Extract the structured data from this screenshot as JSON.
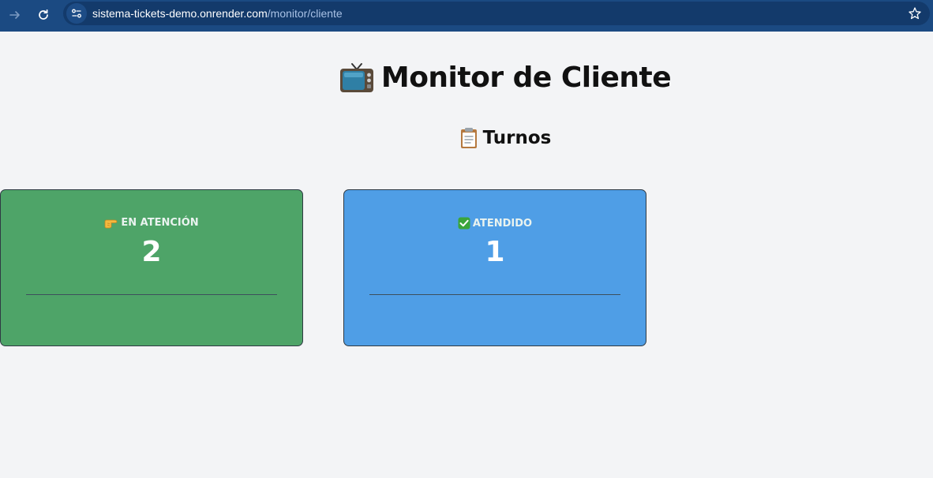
{
  "browser": {
    "url_host": "sistema-tickets-demo.onrender.com",
    "url_path": "/monitor/cliente",
    "icons": {
      "forward": "arrow-right-icon",
      "reload": "reload-icon",
      "site_info": "tune-icon",
      "bookmark": "star-icon"
    },
    "colors": {
      "toolbar": "#1b4a82",
      "address_bar": "#133a6b"
    }
  },
  "page": {
    "title": "Monitor de Cliente",
    "title_icon": "television-emoji-icon",
    "section_title": "Turnos",
    "section_icon": "clipboard-emoji-icon",
    "background": "#f3f4f6"
  },
  "cards": [
    {
      "label": "EN ATENCIÓN",
      "icon": "pointing-hand-emoji-icon",
      "count": "2",
      "color": "#4ea468"
    },
    {
      "label": "ATENDIDO",
      "icon": "check-mark-emoji-icon",
      "count": "1",
      "color": "#4f9ee6"
    }
  ]
}
